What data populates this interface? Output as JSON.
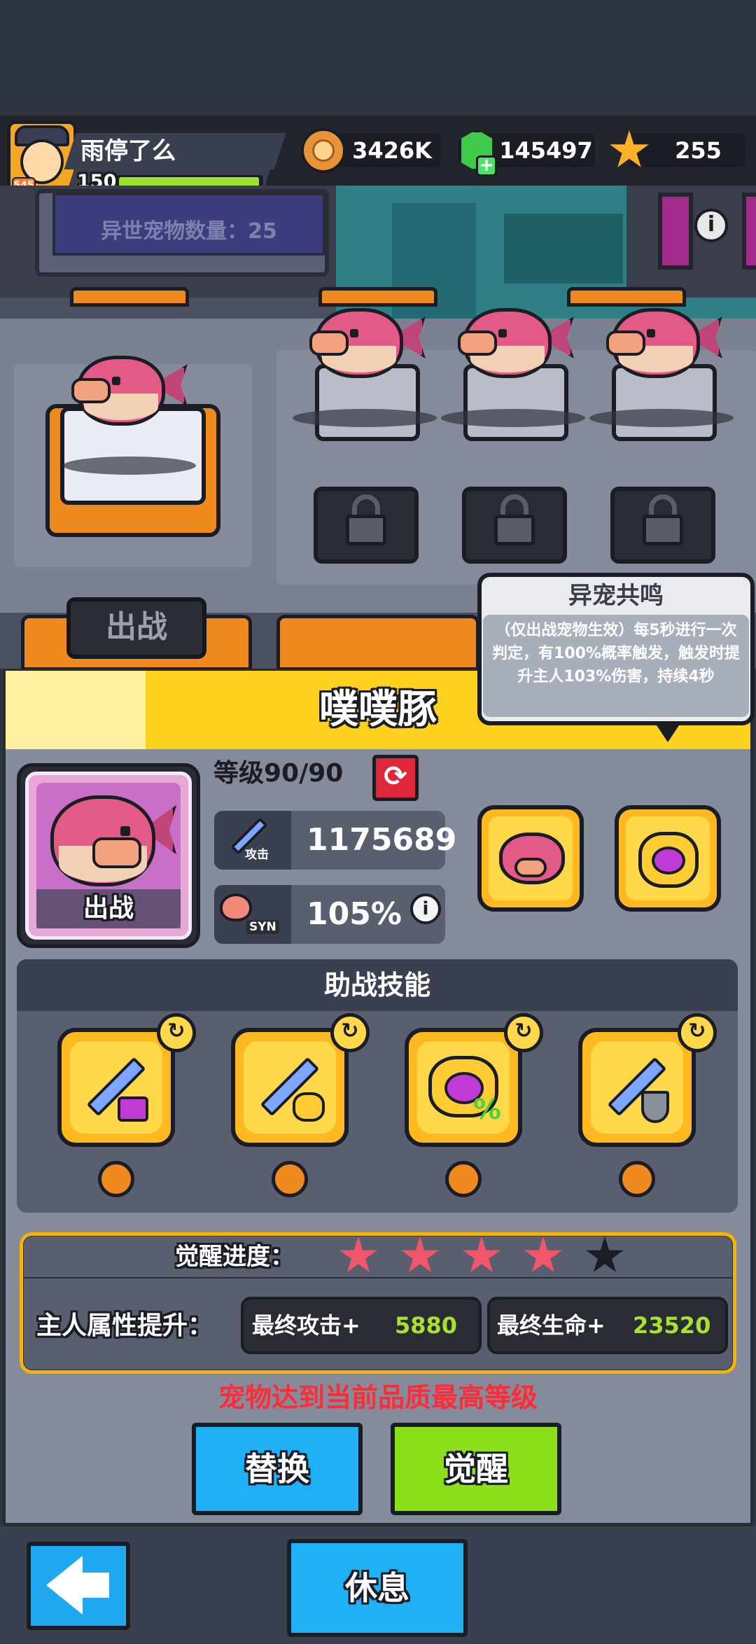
{
  "player": {
    "name": "雨停了么",
    "level": "150",
    "avatar_badge": "545"
  },
  "currencies": {
    "coins": "3426K",
    "gems": "145497",
    "stars": "255"
  },
  "scene": {
    "pet_count_label": "异世宠物数量：25",
    "deploy_label": "出战"
  },
  "tooltip": {
    "title": "异宠共鸣",
    "text": "（仅出战宠物生效）每5秒进行一次判定，有100%概率触发，触发时提升主人103%伤害，持续4秒"
  },
  "pet": {
    "name": "噗噗豚",
    "status_label": "出战",
    "level": "等级90/90",
    "attack_sub": "攻击",
    "attack_value": "1175689",
    "syn_sub": "SYN",
    "syn_value": "105%"
  },
  "skills": {
    "title": "助战技能",
    "items": [
      {
        "icon": "sword-skull-icon"
      },
      {
        "icon": "sword-pet-icon"
      },
      {
        "icon": "pet-percent-icon"
      },
      {
        "icon": "sword-shield-icon"
      }
    ]
  },
  "awaken": {
    "progress_label": "觉醒进度：",
    "stars_filled": 4,
    "stars_total": 5,
    "owner_bonus_label": "主人属性提升：",
    "final_attack_label": "最终攻击+",
    "final_attack_value": "5880",
    "final_hp_label": "最终生命+",
    "final_hp_value": "23520"
  },
  "max_level_notice": "宠物达到当前品质最高等级",
  "buttons": {
    "replace": "替换",
    "awaken": "觉醒",
    "rest": "休息"
  },
  "colors": {
    "accent_yellow": "#ffd21f",
    "blue_button": "#1fb0f5",
    "green_button": "#8be01a",
    "warning_red": "#ff2b37",
    "value_green": "#a6e22e"
  }
}
